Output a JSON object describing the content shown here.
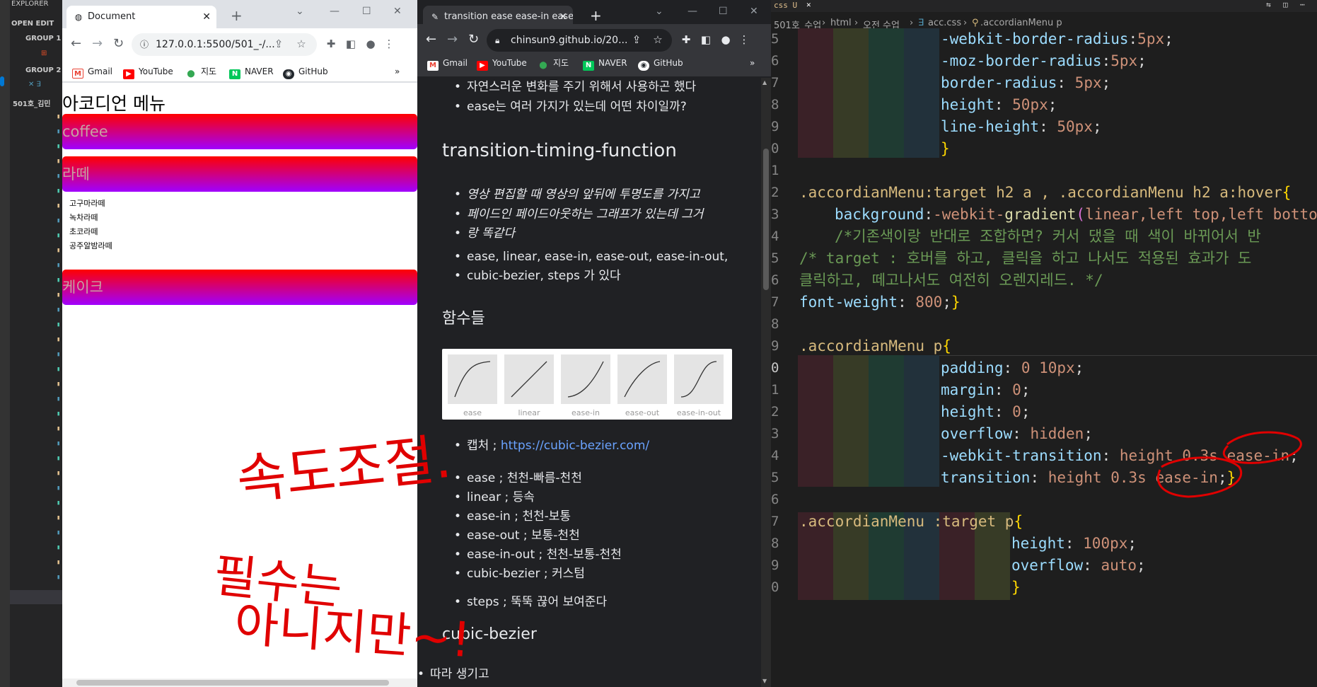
{
  "vscode_sidebar": {
    "explorer": "EXPLORER",
    "open_editors": "OPEN EDIT",
    "group1": "GROUP 1",
    "group2": "GROUP 2",
    "folder": "501호_김민"
  },
  "browser_left": {
    "tab_title": "Document",
    "url": "127.0.0.1:5500/501_-/...",
    "bookmarks": [
      "Gmail",
      "YouTube",
      "지도",
      "NAVER",
      "GitHub"
    ],
    "page": {
      "title": "아코디언 메뉴",
      "menus": [
        "coffee",
        "라떼",
        "케이크"
      ],
      "latte_items": [
        "고구마라떼",
        "녹차라떼",
        "초코라떼",
        "공주알밤라떼"
      ]
    }
  },
  "browser_right": {
    "tab_title": "transition ease ease-in ease-",
    "url": "chinsun9.github.io/20...",
    "bookmarks": [
      "Gmail",
      "YouTube",
      "지도",
      "NAVER",
      "GitHub"
    ],
    "page": {
      "bullets_top": [
        "자연스러운 변화를 주기 위해서 사용하곤 했다",
        "ease는 여러 가지가 있는데 어떤 차이일까?"
      ],
      "heading1": "transition-timing-function",
      "bullet_italic": [
        "영상 편집할 때 영상의 앞뒤에 투명도를 가지고",
        "페이드인 페이드아웃하는 그래프가 있는데 그거",
        "랑 똑같다"
      ],
      "bullet_funcs": [
        "ease, linear, ease-in, ease-out, ease-in-out,",
        "cubic-bezier, steps 가 있다"
      ],
      "heading2": "함수들",
      "curve_labels": [
        "ease",
        "linear",
        "ease-in",
        "ease-out",
        "ease-in-out"
      ],
      "capture_label": "캡처 ; ",
      "capture_link": "https://cubic-bezier.com/",
      "list": [
        "ease ; 천천-빠름-천천",
        "linear ; 등속",
        "ease-in ; 천천-보통",
        "ease-out ; 보통-천천",
        "ease-in-out ; 천천-보통-천천",
        "cubic-bezier ; 커스텀"
      ],
      "steps": "steps ; 뚝뚝 끊어 보여준다",
      "heading3": "cubic-bezier",
      "cut_text": "따라 생기고"
    }
  },
  "editor": {
    "tab_label": "css U",
    "breadcrumb": [
      "501호_수업",
      "html",
      "오전 수업",
      "acc.css",
      ".accordianMenu p"
    ],
    "line_numbers": [
      "5",
      "6",
      "7",
      "8",
      "9",
      "0",
      "1",
      "2",
      "3",
      "4",
      "5",
      "6",
      "7",
      "8",
      "9",
      "0",
      "1",
      "2",
      "3",
      "4",
      "5",
      "6",
      "7",
      "8",
      "9",
      "0"
    ]
  },
  "annotations": {
    "note1": "속도조절.",
    "note2": "필수는",
    "note3": "아니지만~!"
  },
  "colors": {
    "accordion_top": "#ff0000",
    "accordion_bottom": "#a000ff",
    "ink": "#e00000"
  }
}
